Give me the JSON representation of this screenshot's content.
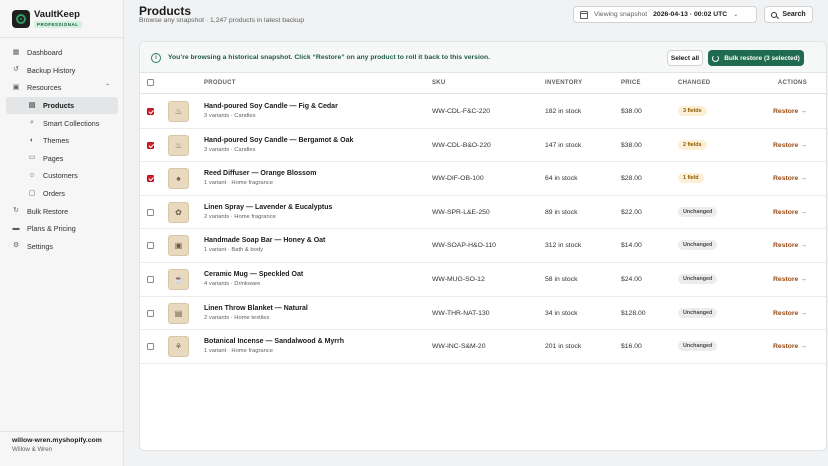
{
  "sidebar": {
    "brand": {
      "name": "VaultKeep",
      "badge": "PROFESSIONAL"
    },
    "items": [
      {
        "label": "Dashboard",
        "icon": "grid-icon"
      },
      {
        "label": "Backup History",
        "icon": "history-icon"
      },
      {
        "label": "Resources",
        "icon": "box-icon"
      },
      {
        "label": "Products",
        "icon": "tag-icon"
      },
      {
        "label": "Smart Collections",
        "icon": "search-icon"
      },
      {
        "label": "Themes",
        "icon": "palette-icon"
      },
      {
        "label": "Pages",
        "icon": "page-icon"
      },
      {
        "label": "Customers",
        "icon": "person-icon"
      },
      {
        "label": "Orders",
        "icon": "order-icon"
      },
      {
        "label": "Bulk Restore",
        "icon": "restore-icon"
      },
      {
        "label": "Plans & Pricing",
        "icon": "card-icon"
      },
      {
        "label": "Settings",
        "icon": "gear-icon"
      }
    ],
    "store": {
      "domain": "willow-wren.myshopify.com",
      "name": "Willow & Wren"
    }
  },
  "header": {
    "title": "Products",
    "subtitle": "Browse any snapshot · 1,247 products in latest backup",
    "snapshot_label": "Viewing snapshot",
    "snapshot_value": "2026-04-13 · 00:02 UTC",
    "search_label": "Search"
  },
  "banner": {
    "message": "You’re browsing a historical snapshot. Click “Restore” on any product to roll it back to this version.",
    "select_all": "Select all",
    "bulk_restore": "Bulk restore (3 selected)"
  },
  "table": {
    "columns": {
      "product": "PRODUCT",
      "sku": "SKU",
      "inventory": "INVENTORY",
      "price": "PRICE",
      "changed": "CHANGED",
      "actions": "ACTIONS"
    },
    "rows": [
      {
        "name": "Hand-poured Soy Candle — Fig & Cedar",
        "meta": "3 variants · Candles",
        "sku": "WW-CDL-F&C-220",
        "inventory": "182 in stock",
        "price": "$38.00",
        "changed": "3 fields",
        "status": "changed",
        "checked": true,
        "action": "Restore →"
      },
      {
        "name": "Hand-poured Soy Candle — Bergamot & Oak",
        "meta": "3 variants · Candles",
        "sku": "WW-CDL-B&O-220",
        "inventory": "147 in stock",
        "price": "$38.00",
        "changed": "2 fields",
        "status": "changed",
        "checked": true,
        "action": "Restore →"
      },
      {
        "name": "Reed Diffuser — Orange Blossom",
        "meta": "1 variant · Home fragrance",
        "sku": "WW-DIF-OB-100",
        "inventory": "64 in stock",
        "price": "$28.00",
        "changed": "1 field",
        "status": "changed",
        "checked": true,
        "action": "Restore →"
      },
      {
        "name": "Linen Spray — Lavender & Eucalyptus",
        "meta": "2 variants · Home fragrance",
        "sku": "WW-SPR-L&E-250",
        "inventory": "89 in stock",
        "price": "$22.00",
        "changed": "Unchanged",
        "status": "same",
        "checked": false,
        "action": "Restore →"
      },
      {
        "name": "Handmade Soap Bar — Honey & Oat",
        "meta": "1 variant · Bath & body",
        "sku": "WW-SOAP-H&O-110",
        "inventory": "312 in stock",
        "price": "$14.00",
        "changed": "Unchanged",
        "status": "same",
        "checked": false,
        "action": "Restore →"
      },
      {
        "name": "Ceramic Mug — Speckled Oat",
        "meta": "4 variants · Drinkware",
        "sku": "WW-MUG-SO-12",
        "inventory": "58 in stock",
        "price": "$24.00",
        "changed": "Unchanged",
        "status": "same",
        "checked": false,
        "action": "Restore →"
      },
      {
        "name": "Linen Throw Blanket — Natural",
        "meta": "2 variants · Home textiles",
        "sku": "WW-THR-NAT-130",
        "inventory": "34 in stock",
        "price": "$128.00",
        "changed": "Unchanged",
        "status": "same",
        "checked": false,
        "action": "Restore →"
      },
      {
        "name": "Botanical Incense — Sandalwood & Myrrh",
        "meta": "1 variant · Home fragrance",
        "sku": "WW-INC-S&M-20",
        "inventory": "201 in stock",
        "price": "$16.00",
        "changed": "Unchanged",
        "status": "same",
        "checked": false,
        "action": "Restore →"
      }
    ]
  },
  "colors": {
    "accent": "#1f6b4f",
    "checkbox": "#d61f2c",
    "restore_link": "#9a4a12"
  }
}
